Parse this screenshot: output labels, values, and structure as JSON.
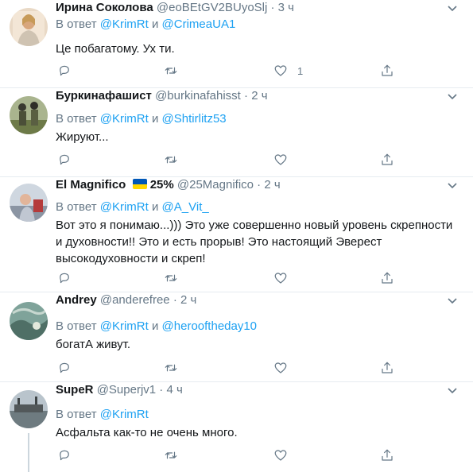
{
  "tweets": [
    {
      "name": "Ирина Соколова",
      "handle": "@eoBEtGV2BUyoSlj",
      "dot": "·",
      "time": "3 ч",
      "reply_prefix": "В ответ",
      "reply_to_1": "@KrimRt",
      "reply_and": "и",
      "reply_to_2": "@CrimeaUA1",
      "text": "Це побагатому. Ух ти.",
      "likes": "1"
    },
    {
      "name": "Буркинафашист",
      "handle": "@burkinafahisst",
      "dot": "·",
      "time": "2 ч",
      "reply_prefix": "В ответ",
      "reply_to_1": "@KrimRt",
      "reply_and": "и",
      "reply_to_2": "@Shtirlitz53",
      "text": "Жируют...",
      "likes": ""
    },
    {
      "name": "El Magnifico",
      "name_suffix": "25%",
      "handle": "@25Magnifico",
      "dot": "·",
      "time": "2 ч",
      "reply_prefix": "В ответ",
      "reply_to_1": "@KrimRt",
      "reply_and": "и",
      "reply_to_2": "@A_Vit_",
      "text": "Вот это я понимаю...))) Это уже совершенно новый уровень скрепности и духовности!! Это и есть прорыв! Это настоящий Эверест высокодуховности и скреп!",
      "likes": "",
      "flag_colors": [
        "#0057b7",
        "#ffd700"
      ]
    },
    {
      "name": "Andrey",
      "handle": "@anderefree",
      "dot": "·",
      "time": "2 ч",
      "reply_prefix": "В ответ",
      "reply_to_1": "@KrimRt",
      "reply_and": "и",
      "reply_to_2": "@herooftheday10",
      "text": "богатА живут.",
      "likes": ""
    },
    {
      "name": "SupeR",
      "handle": "@Superjv1",
      "dot": "·",
      "time": "4 ч",
      "reply_prefix": "В ответ",
      "reply_to_1": "@KrimRt",
      "text": "Асфальта как-то не очень много.",
      "likes": ""
    }
  ],
  "icons": {
    "reply": "reply-icon",
    "retweet": "retweet-icon",
    "like": "heart-icon",
    "share": "share-icon",
    "more": "chevron-down-icon"
  },
  "colors": {
    "link": "#1da1f2",
    "secondary": "#657786",
    "divider": "#e6ecf0",
    "text": "#14171a"
  }
}
